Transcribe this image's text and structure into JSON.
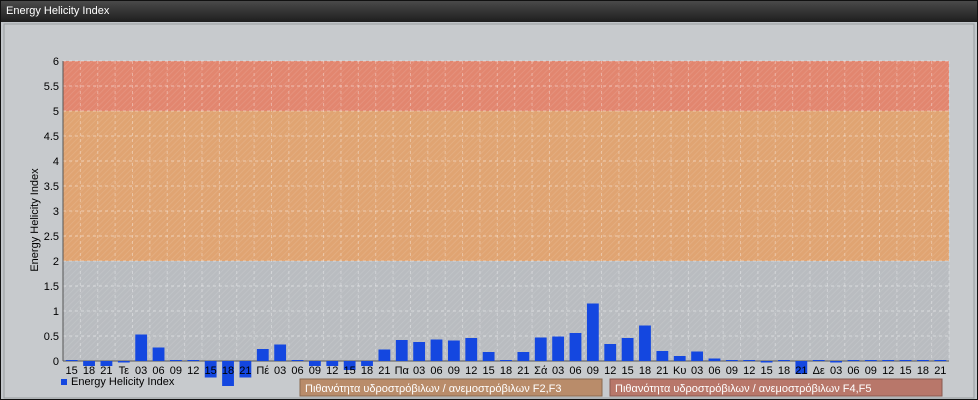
{
  "window": {
    "title": "Energy Helicity Index"
  },
  "colors": {
    "bar": "#1447e0",
    "band_low": "#b9bcc0",
    "band_mid": "#e0a472",
    "band_high": "#e2866f",
    "legend_f23": "#b98c6a",
    "legend_f45": "#b8776a"
  },
  "chart_data": {
    "type": "bar",
    "ylabel": "Energy Helicity Index",
    "ylim": [
      0,
      6
    ],
    "yticks": [
      "0",
      "0.5",
      "1",
      "1.5",
      "2",
      "2.5",
      "3",
      "3.5",
      "4",
      "4.5",
      "5",
      "5.5",
      "6"
    ],
    "categories": [
      "15",
      "18",
      "21",
      "Τε",
      "03",
      "06",
      "09",
      "12",
      "15",
      "18",
      "21",
      "Πέ",
      "03",
      "06",
      "09",
      "12",
      "15",
      "18",
      "21",
      "Πα",
      "03",
      "06",
      "09",
      "12",
      "15",
      "18",
      "21",
      "Σά",
      "03",
      "06",
      "09",
      "12",
      "15",
      "18",
      "21",
      "Κυ",
      "03",
      "06",
      "09",
      "12",
      "15",
      "18",
      "21",
      "Δε",
      "03",
      "06",
      "09",
      "12",
      "15",
      "18",
      "21"
    ],
    "series": [
      {
        "name": "Energy Helicity Index",
        "values": [
          0.01,
          -0.1,
          -0.1,
          -0.03,
          0.53,
          0.27,
          0.02,
          0.01,
          -0.33,
          -0.5,
          -0.33,
          0.24,
          0.33,
          0.01,
          -0.1,
          -0.1,
          -0.18,
          -0.1,
          0.23,
          0.42,
          0.38,
          0.43,
          0.41,
          0.46,
          0.18,
          0.01,
          0.18,
          0.47,
          0.49,
          0.56,
          1.15,
          0.34,
          0.46,
          0.71,
          0.2,
          0.1,
          0.19,
          0.05,
          0.02,
          0.02,
          -0.03,
          0.02,
          -0.26,
          0.02,
          -0.03,
          0.02,
          0.02,
          0.02,
          0.02,
          0.02,
          0.02
        ]
      }
    ],
    "bands": [
      {
        "from": 0,
        "to": 2,
        "color_key": "band_low"
      },
      {
        "from": 2,
        "to": 5,
        "color_key": "band_mid"
      },
      {
        "from": 5,
        "to": 6,
        "color_key": "band_high"
      }
    ]
  },
  "legend": {
    "series_label": "Energy Helicity Index",
    "band_f23": "Πιθανότητα υδροστρόβιλων / ανεμοστρόβιλων F2,F3",
    "band_f45": "Πιθανότητα υδροστρόβιλων / ανεμοστρόβιλων F4,F5"
  }
}
